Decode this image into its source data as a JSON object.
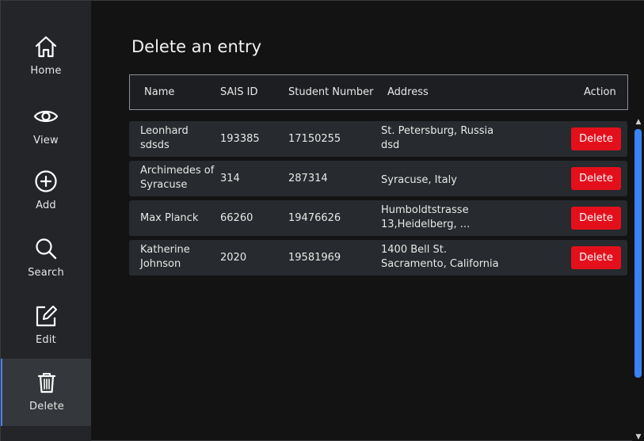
{
  "sidebar": {
    "items": [
      {
        "label": "Home",
        "icon": "home-icon"
      },
      {
        "label": "View",
        "icon": "eye-icon"
      },
      {
        "label": "Add",
        "icon": "plus-circle-icon"
      },
      {
        "label": "Search",
        "icon": "search-icon"
      },
      {
        "label": "Edit",
        "icon": "edit-icon"
      },
      {
        "label": "Delete",
        "icon": "trash-icon",
        "active": true
      }
    ]
  },
  "main": {
    "title": "Delete an entry",
    "columns": [
      "Name",
      "SAIS ID",
      "Student Number",
      "Address",
      "Action"
    ],
    "rows": [
      {
        "name": [
          "Leonhard",
          "sdsds"
        ],
        "sais_id": "193385",
        "student_number": "17150255",
        "address": [
          "St. Petersburg, Russia",
          "dsd"
        ],
        "action": "Delete"
      },
      {
        "name": [
          "Archimedes of",
          "Syracuse"
        ],
        "sais_id": "314",
        "student_number": "287314",
        "address": [
          "Syracuse, Italy"
        ],
        "action": "Delete"
      },
      {
        "name": [
          "Max Planck"
        ],
        "sais_id": "66260",
        "student_number": "19476626",
        "address": [
          "Humboldtstrasse",
          "13,Heidelberg, ..."
        ],
        "action": "Delete"
      },
      {
        "name": [
          "Katherine",
          "Johnson"
        ],
        "sais_id": "2020",
        "student_number": "19581969",
        "address": [
          "1400 Bell St.",
          "Sacramento, California"
        ],
        "action": "Delete"
      }
    ]
  },
  "colors": {
    "sidebar_bg": "#232528",
    "background": "#131314",
    "row_bg": "#272a2e",
    "delete_button": "#e3101c",
    "accent": "#4a86f0",
    "scroll_thumb": "#3b82f6"
  }
}
